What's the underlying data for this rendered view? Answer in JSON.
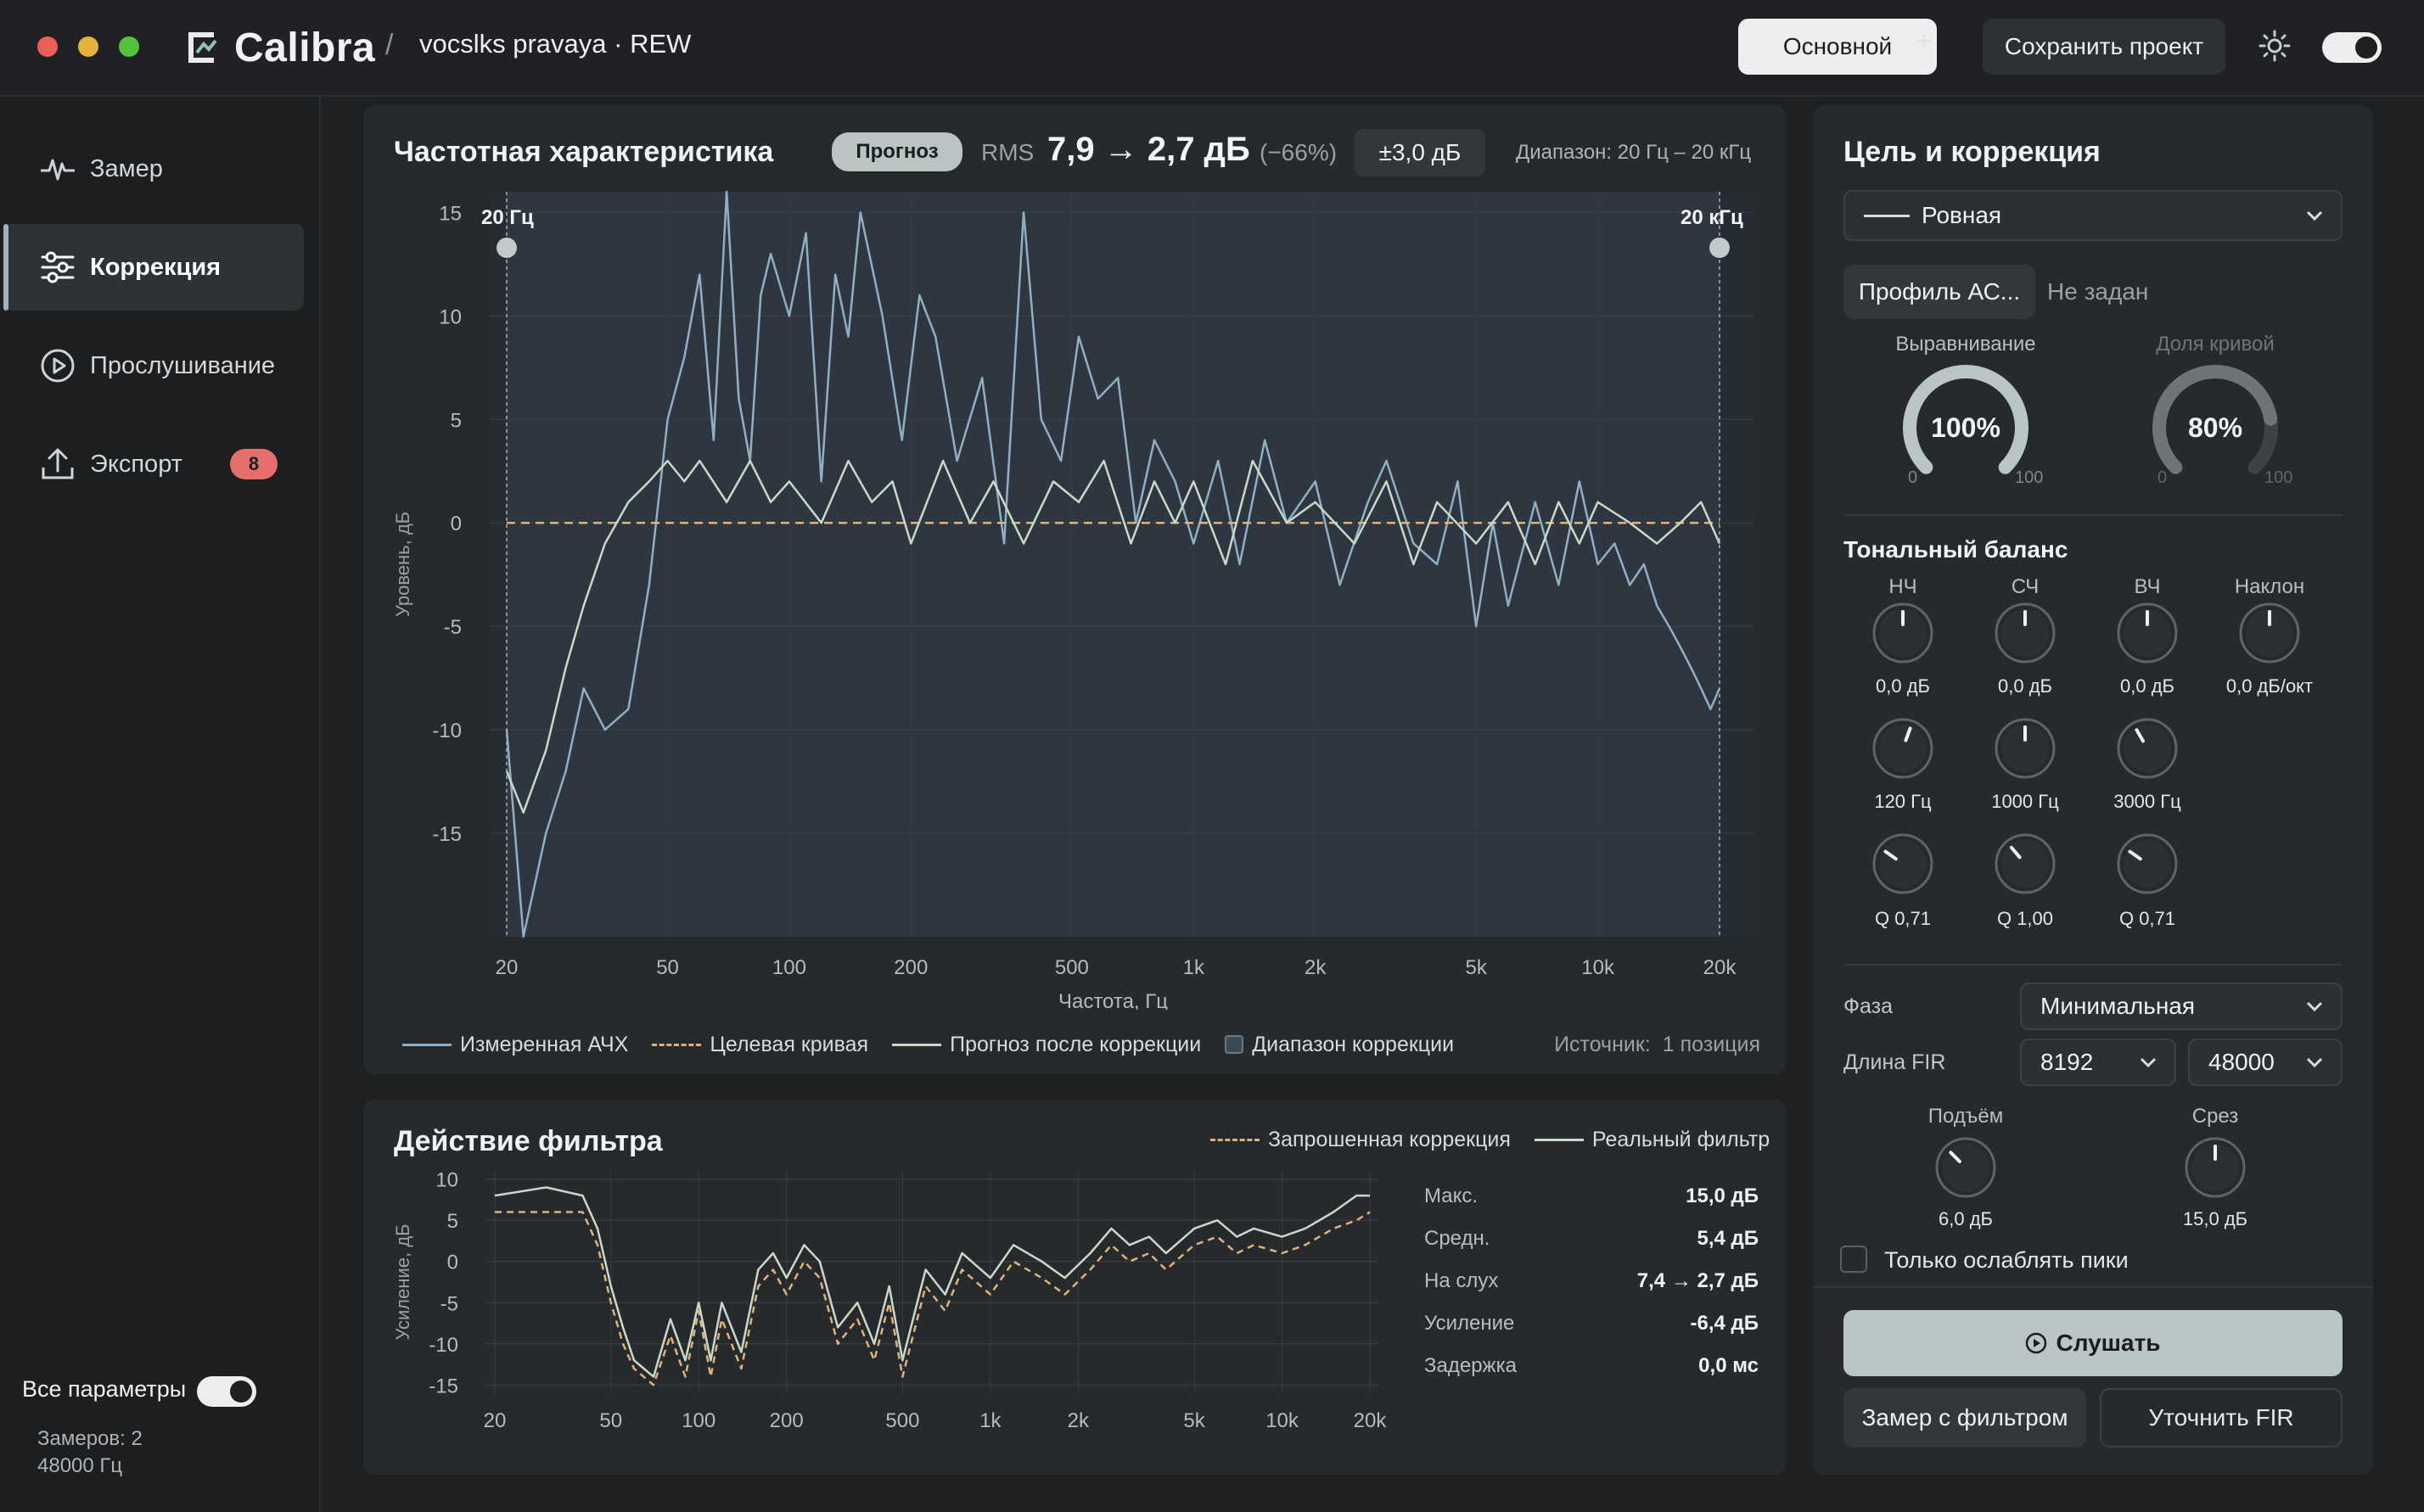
{
  "window": {
    "app_name": "Calibra",
    "breadcrumb_sep": "/",
    "project": "vocslks pravaya · REW",
    "btn_main": "Основной",
    "btn_plus": "+",
    "btn_save": "Сохранить проект"
  },
  "sidebar": {
    "items": [
      {
        "label": "Замер",
        "icon": "waveform-icon"
      },
      {
        "label": "Коррекция",
        "icon": "sliders-icon"
      },
      {
        "label": "Прослушивание",
        "icon": "play-circle-icon"
      },
      {
        "label": "Экспорт",
        "icon": "upload-icon",
        "badge": "8"
      }
    ],
    "all_params_label": "Все параметры",
    "measure_count": "Замеров: 2",
    "sample_rate": "48000 Гц"
  },
  "freq_panel": {
    "title": "Частотная характеристика",
    "forecast_pill": "Прогноз",
    "rms_label": "RMS",
    "rms_value": "7,9 → 2,7 дБ",
    "rms_pct": "(−66%)",
    "tolerance": "±3,0 дБ",
    "range_text": "Диапазон: 20 Гц – 20 кГц",
    "marker_low": "20 Гц",
    "marker_high": "20 кГц",
    "legend": {
      "measured": "Измеренная АЧХ",
      "target": "Целевая кривая",
      "forecast": "Прогноз после коррекции",
      "range": "Диапазон коррекции",
      "source_label": "Источник:",
      "source_value": "1 позиция"
    }
  },
  "filter_panel": {
    "title": "Действие фильтра",
    "legend_requested": "Запрошенная коррекция",
    "legend_real": "Реальный фильтр",
    "stats": [
      {
        "label": "Макс.",
        "value": "15,0 дБ"
      },
      {
        "label": "Средн.",
        "value": "5,4 дБ"
      },
      {
        "label": "На слух",
        "value": "7,4 → 2,7 дБ"
      },
      {
        "label": "Усиление",
        "value": "-6,4 дБ"
      },
      {
        "label": "Задержка",
        "value": "0,0 мс"
      }
    ]
  },
  "right_panel": {
    "title": "Цель и коррекция",
    "target_select": "Ровная",
    "profile_btn": "Профиль АС...",
    "profile_state": "Не задан",
    "dial_align": {
      "label": "Выравнивание",
      "value": "100%",
      "min": "0",
      "max": "100",
      "level": 1.0
    },
    "dial_share": {
      "label": "Доля кривой",
      "value": "80%",
      "min": "0",
      "max": "100",
      "level": 0.8
    },
    "tonal_title": "Тональный баланс",
    "tonal_cols": [
      "НЧ",
      "СЧ",
      "ВЧ",
      "Наклон"
    ],
    "tonal_gain": [
      "0,0 дБ",
      "0,0 дБ",
      "0,0 дБ",
      "0,0 дБ/окт"
    ],
    "tonal_freq": [
      "120 Гц",
      "1000 Гц",
      "3000 Гц"
    ],
    "tonal_q": [
      "Q 0,71",
      "Q 1,00",
      "Q 0,71"
    ],
    "phase_label": "Фаза",
    "phase_value": "Минимальная",
    "fir_label": "Длина FIR",
    "fir_length": "8192",
    "fir_rate": "48000",
    "rise_label": "Подъём",
    "rise_value": "6,0 дБ",
    "cut_label": "Срез",
    "cut_value": "15,0 дБ",
    "cut_only_label": "Только ослаблять пики",
    "btn_listen": "Слушать",
    "btn_measure_filter": "Замер с фильтром",
    "btn_refine": "Уточнить FIR"
  },
  "colors": {
    "measured": "#8fb0c4",
    "target": "#e0b27a",
    "forecast": "#c9d9c8",
    "accent": "#b9c6c5",
    "badge": "#e5706b"
  },
  "chart_data": [
    {
      "type": "line",
      "xlabel": "Частота, Гц",
      "ylabel": "Уровень, дБ",
      "x_scale": "log",
      "xlim": [
        20,
        20000
      ],
      "ylim": [
        -20,
        16
      ],
      "x_ticks": [
        "20",
        "50",
        "100",
        "200",
        "500",
        "1k",
        "2k",
        "5k",
        "10k",
        "20k"
      ],
      "y_ticks": [
        "15",
        "10",
        "5",
        "0",
        "-5",
        "-10",
        "-15"
      ],
      "series": [
        {
          "name": "Измеренная АЧХ",
          "x": [
            20,
            22,
            25,
            28,
            31,
            35,
            40,
            45,
            50,
            55,
            60,
            65,
            70,
            75,
            80,
            85,
            90,
            100,
            110,
            120,
            130,
            140,
            150,
            170,
            190,
            210,
            230,
            260,
            300,
            340,
            380,
            420,
            470,
            520,
            580,
            650,
            720,
            800,
            900,
            1000,
            1150,
            1300,
            1500,
            1700,
            2000,
            2300,
            2700,
            3000,
            3500,
            4000,
            4500,
            5000,
            5500,
            6000,
            7000,
            8000,
            9000,
            10000,
            11000,
            12000,
            13000,
            14000,
            15000,
            16000,
            17000,
            18000,
            19000,
            20000
          ],
          "y": [
            -10,
            -20,
            -15,
            -12,
            -8,
            -10,
            -9,
            -3,
            5,
            8,
            12,
            4,
            16,
            6,
            3,
            11,
            13,
            10,
            14,
            2,
            12,
            9,
            15,
            10,
            4,
            11,
            9,
            3,
            7,
            -1,
            15,
            5,
            3,
            9,
            6,
            7,
            0,
            4,
            2,
            -1,
            3,
            -2,
            4,
            0,
            2,
            -3,
            1,
            3,
            -1,
            -2,
            2,
            -5,
            0,
            -4,
            1,
            -3,
            2,
            -2,
            -1,
            -3,
            -2,
            -4,
            -5,
            -6,
            -7,
            -8,
            -9,
            -8
          ]
        },
        {
          "name": "Целевая кривая",
          "x": [
            20,
            20000
          ],
          "y": [
            0,
            0
          ]
        },
        {
          "name": "Прогноз после коррекции",
          "x": [
            20,
            22,
            25,
            28,
            31,
            35,
            40,
            45,
            50,
            55,
            60,
            70,
            80,
            90,
            100,
            120,
            140,
            160,
            180,
            200,
            240,
            280,
            320,
            380,
            450,
            520,
            600,
            700,
            800,
            900,
            1000,
            1200,
            1400,
            1700,
            2000,
            2500,
            3000,
            3500,
            4000,
            5000,
            6000,
            7000,
            8000,
            9000,
            10000,
            12000,
            14000,
            16000,
            18000,
            20000
          ],
          "y": [
            -12,
            -14,
            -11,
            -7,
            -4,
            -1,
            1,
            2,
            3,
            2,
            3,
            1,
            3,
            1,
            2,
            0,
            3,
            1,
            2,
            -1,
            3,
            0,
            2,
            -1,
            2,
            1,
            3,
            -1,
            2,
            0,
            2,
            -2,
            3,
            0,
            1,
            -1,
            2,
            -2,
            1,
            -1,
            1,
            -2,
            1,
            -1,
            1,
            0,
            -1,
            0,
            1,
            -1
          ]
        }
      ]
    },
    {
      "type": "line",
      "ylabel": "Усиление, дБ",
      "x_scale": "log",
      "xlim": [
        20,
        20000
      ],
      "ylim": [
        -16,
        11
      ],
      "x_ticks": [
        "20",
        "50",
        "100",
        "200",
        "500",
        "1k",
        "2k",
        "5k",
        "10k",
        "20k"
      ],
      "y_ticks": [
        "10",
        "5",
        "0",
        "-5",
        "-10",
        "-15"
      ],
      "series": [
        {
          "name": "Запрошенная коррекция",
          "x": [
            20,
            30,
            40,
            45,
            50,
            55,
            60,
            70,
            80,
            90,
            100,
            110,
            120,
            140,
            160,
            180,
            200,
            230,
            260,
            300,
            350,
            400,
            450,
            500,
            600,
            700,
            800,
            1000,
            1200,
            1500,
            1800,
            2200,
            2600,
            3000,
            3500,
            4000,
            5000,
            6000,
            7000,
            8000,
            10000,
            12000,
            15000,
            18000,
            20000
          ],
          "y": [
            6,
            6,
            6,
            2,
            -5,
            -10,
            -13,
            -15,
            -9,
            -14,
            -6,
            -14,
            -7,
            -13,
            -3,
            -1,
            -4,
            0,
            -2,
            -10,
            -7,
            -12,
            -5,
            -14,
            -3,
            -6,
            -1,
            -4,
            0,
            -2,
            -4,
            -1,
            2,
            0,
            1,
            -1,
            2,
            3,
            1,
            2,
            1,
            2,
            4,
            5,
            6
          ]
        },
        {
          "name": "Реальный фильтр",
          "x": [
            20,
            30,
            40,
            45,
            50,
            55,
            60,
            70,
            80,
            90,
            100,
            110,
            120,
            140,
            160,
            180,
            200,
            230,
            260,
            300,
            350,
            400,
            450,
            500,
            600,
            700,
            800,
            1000,
            1200,
            1500,
            1800,
            2200,
            2600,
            3000,
            3500,
            4000,
            5000,
            6000,
            7000,
            8000,
            10000,
            12000,
            15000,
            18000,
            20000
          ],
          "y": [
            8,
            9,
            8,
            4,
            -3,
            -8,
            -12,
            -14,
            -7,
            -12,
            -5,
            -12,
            -5,
            -11,
            -1,
            1,
            -2,
            2,
            0,
            -8,
            -5,
            -10,
            -3,
            -12,
            -1,
            -4,
            1,
            -2,
            2,
            0,
            -2,
            1,
            4,
            2,
            3,
            1,
            4,
            5,
            3,
            4,
            3,
            4,
            6,
            8,
            8
          ]
        }
      ]
    }
  ]
}
